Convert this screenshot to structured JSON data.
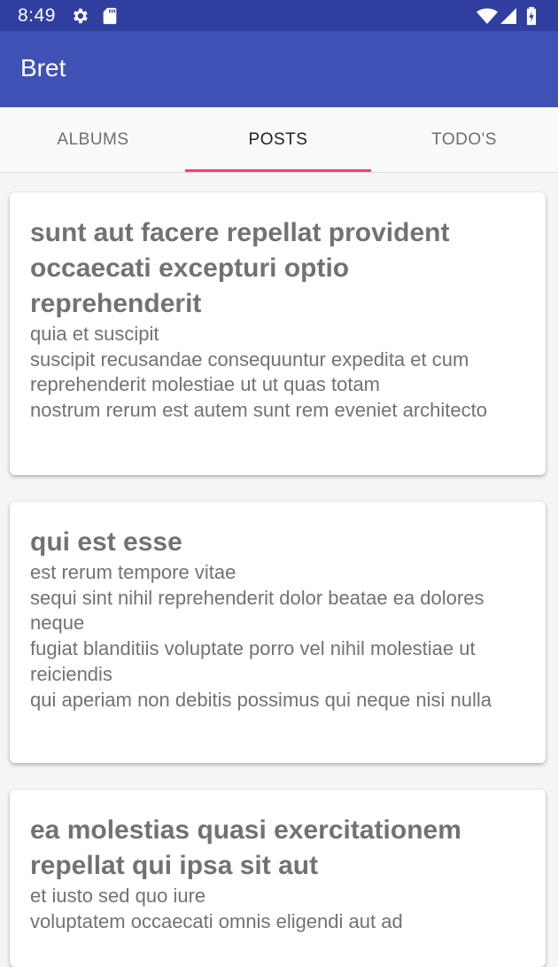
{
  "status_bar": {
    "time": "8:49",
    "left_icons": [
      "gear-icon",
      "sd-card-icon"
    ],
    "right_icons": [
      "wifi-icon",
      "cellular-signal-icon",
      "battery-charging-icon"
    ]
  },
  "app_bar": {
    "title": "Bret"
  },
  "tabs": [
    {
      "label": "ALBUMS"
    },
    {
      "label": "POSTS",
      "active": true
    },
    {
      "label": "TODO'S"
    }
  ],
  "posts": [
    {
      "title": "sunt aut facere repellat provident occaecati excepturi optio reprehenderit",
      "body": "quia et suscipit\nsuscipit recusandae consequuntur expedita et cum reprehenderit molestiae ut ut quas totam\nnostrum rerum est autem sunt rem eveniet architecto"
    },
    {
      "title": "qui est esse",
      "body": "est rerum tempore vitae\nsequi sint nihil reprehenderit dolor beatae ea dolores neque\nfugiat blanditiis voluptate porro vel nihil molestiae ut reiciendis\nqui aperiam non debitis possimus qui neque nisi nulla"
    },
    {
      "title": "ea molestias quasi exercitationem repellat qui ipsa sit aut",
      "body": "et iusto sed quo iure\nvoluptatem occaecati omnis eligendi aut ad"
    }
  ],
  "colors": {
    "status_bar": "#303f9f",
    "app_bar": "#3f51b5",
    "tab_indicator": "#e8467c",
    "card_text": "#727272"
  }
}
